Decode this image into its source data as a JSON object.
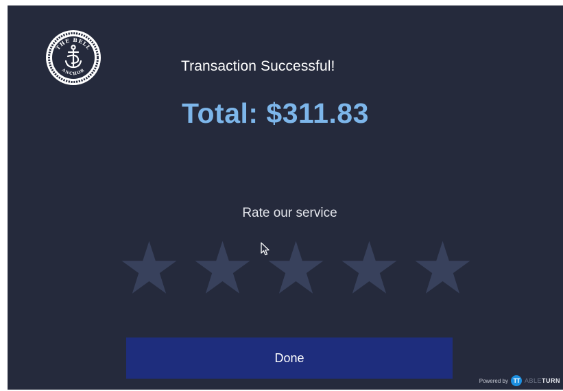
{
  "brand": {
    "logo_text_top": "THE BELL",
    "logo_text_bottom": "ANCHOR",
    "logo_icon": "anchor-icon"
  },
  "receipt": {
    "status": "Transaction Successful!",
    "total": "Total: $311.83"
  },
  "rating": {
    "prompt": "Rate our service",
    "max_stars": 5,
    "selected": 0,
    "star_color": "#38415c"
  },
  "actions": {
    "done_label": "Done"
  },
  "footer": {
    "powered_by": "Powered by",
    "tt_mark": "TT",
    "brand_light": "ABLE",
    "brand_dark": "TURN"
  },
  "colors": {
    "background": "#252a3c",
    "accent_total": "#7db6ea",
    "button": "#1e2d7d"
  }
}
